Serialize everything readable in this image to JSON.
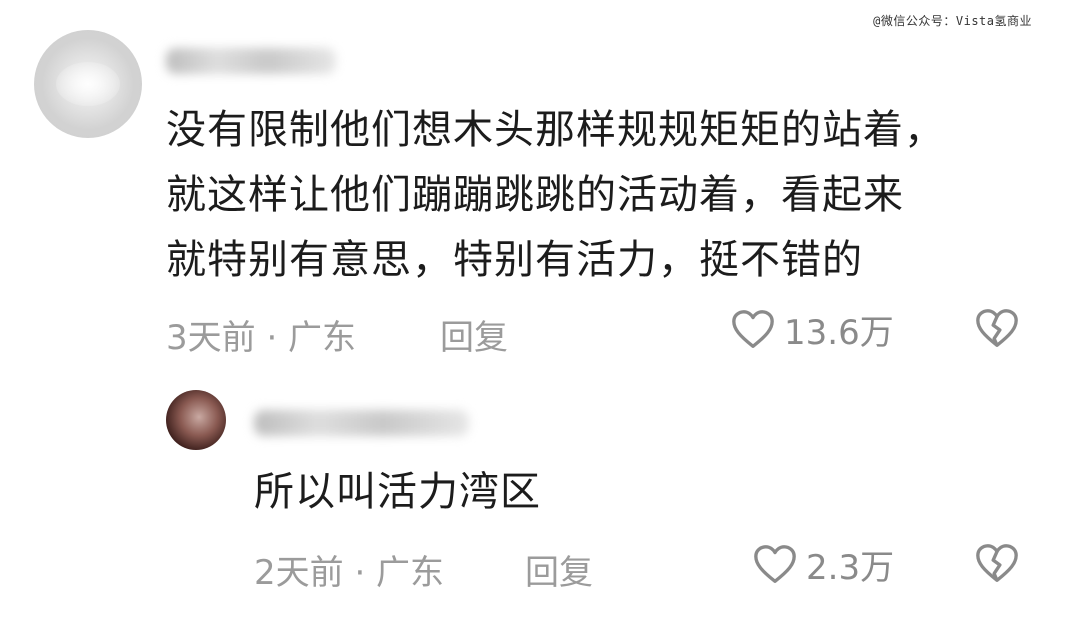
{
  "watermark": "@微信公众号：Vista氢商业",
  "comments": [
    {
      "text": "没有限制他们想木头那样规规矩矩的站着，\n就这样让他们蹦蹦跳跳的活动着，看起来\n就特别有意思，特别有活力，挺不错的",
      "meta": "3天前 · 广东",
      "reply_label": "回复",
      "likes": "13.6万",
      "icons": [
        "heart-icon",
        "broken-heart-icon"
      ]
    },
    {
      "text": "所以叫活力湾区",
      "meta": "2天前 · 广东",
      "reply_label": "回复",
      "likes": "2.3万",
      "icons": [
        "heart-icon",
        "broken-heart-icon"
      ]
    }
  ]
}
